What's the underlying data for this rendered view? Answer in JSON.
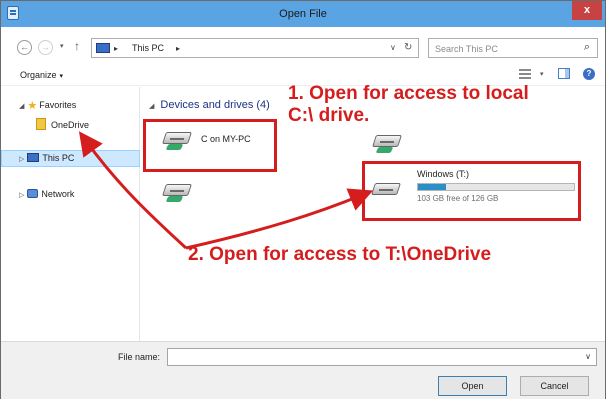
{
  "window": {
    "title": "Open File",
    "close_glyph": "x"
  },
  "addressbar": {
    "back_glyph": "←",
    "forward_glyph": "→",
    "history_glyph": "▾",
    "up_glyph": "↑",
    "sep_glyph": "▸",
    "location": "This PC",
    "dropdown_glyph": "∨",
    "refresh_glyph": "↻",
    "search_placeholder": "Search This PC",
    "search_glyph": "⌕"
  },
  "toolbar": {
    "organize_label": "Organize",
    "caret": "▾",
    "help_glyph": "?"
  },
  "nav": {
    "favorites": {
      "expander": "◢",
      "icon": "★",
      "label": "Favorites"
    },
    "onedrive": {
      "label": "OneDrive"
    },
    "this_pc": {
      "expander": "▷",
      "label": "This PC"
    },
    "network": {
      "expander": "▷",
      "label": "Network"
    }
  },
  "content": {
    "group_expander": "◢",
    "group_header": "Devices and drives (4)",
    "drives": {
      "c": {
        "label": "C on MY-PC"
      },
      "t": {
        "label": "Windows (T:)",
        "free_text": "103 GB free of 126 GB",
        "used_fraction": 0.18
      }
    }
  },
  "footer": {
    "filename_label": "File name:",
    "filename_value": "",
    "dropdown_glyph": "∨",
    "open_label": "Open",
    "cancel_label": "Cancel"
  },
  "annotations": {
    "note1_line1": "1. Open for access to local",
    "note1_line2": "C:\\ drive.",
    "note2": "2. Open for access to T:\\OneDrive",
    "color": "#d51d1d"
  }
}
